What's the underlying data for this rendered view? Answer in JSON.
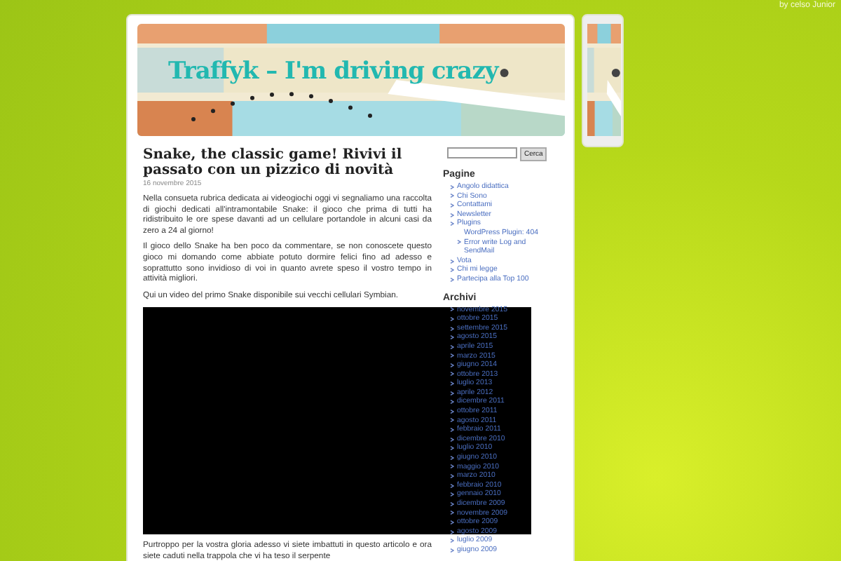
{
  "byline": "by celso Junior",
  "header": {
    "title": "Traffyk – I'm driving crazy"
  },
  "post": {
    "title": "Snake, the classic game! Rivivi il passato con un pizzico di novità",
    "date": "16 novembre 2015",
    "paragraphs": [
      "Nella consueta rubrica dedicata ai videogiochi oggi vi segnaliamo una raccolta di giochi dedicati all'intramontabile Snake: il gioco che prima di tutti ha ridistribuito le ore spese davanti ad un cellulare portandole in alcuni casi da zero a 24 al giorno!",
      "Il gioco dello Snake ha ben poco da commentare, se non conoscete questo gioco mi domando come abbiate potuto dormire felici fino ad adesso e soprattutto sono invidioso di voi in quanto avrete speso il vostro tempo in attività migliori.",
      "Qui un video del primo Snake disponibile sui vecchi cellulari Symbian."
    ],
    "after_video": "Purtroppo per la vostra gloria adesso vi siete imbattuti in questo articolo e ora siete caduti nella trappola che vi ha teso il serpente"
  },
  "search": {
    "button": "Cerca"
  },
  "pages": {
    "heading": "Pagine",
    "items": [
      {
        "label": "Angolo didattica"
      },
      {
        "label": "Chi Sono"
      },
      {
        "label": "Contattami"
      },
      {
        "label": "Newsletter"
      },
      {
        "label": "Plugins",
        "children": [
          {
            "label": "WordPress Plugin: 404 Error write Log and SendMail"
          }
        ]
      },
      {
        "label": "Vota"
      },
      {
        "label": "Chi mi legge"
      },
      {
        "label": "Partecipa alla Top 100"
      }
    ]
  },
  "archives": {
    "heading": "Archivi",
    "items": [
      "novembre 2015",
      "ottobre 2015",
      "settembre 2015",
      "agosto 2015",
      "aprile 2015",
      "marzo 2015",
      "giugno 2014",
      "ottobre 2013",
      "luglio 2013",
      "aprile 2012",
      "dicembre 2011",
      "ottobre 2011",
      "agosto 2011",
      "febbraio 2011",
      "dicembre 2010",
      "luglio 2010",
      "giugno 2010",
      "maggio 2010",
      "marzo 2010",
      "febbraio 2010",
      "gennaio 2010",
      "dicembre 2009",
      "novembre 2009",
      "ottobre 2009",
      "agosto 2009",
      "luglio 2009",
      "giugno 2009"
    ]
  }
}
